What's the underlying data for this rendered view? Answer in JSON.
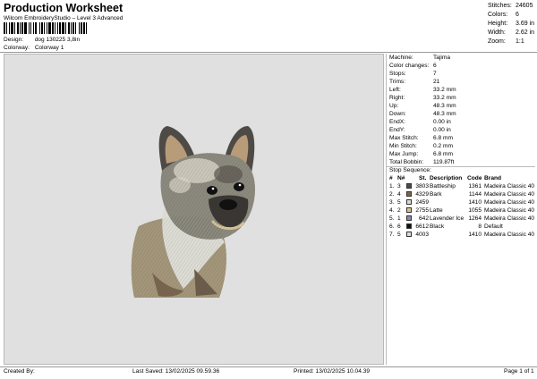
{
  "header": {
    "title": "Production Worksheet",
    "subtitle": "Wilcom EmbroideryStudio – Level 3 Advanced",
    "design_label": "Design:",
    "design_value": "dog 130225 3,8in",
    "colorway_label": "Colorway:",
    "colorway_value": "Colorway 1"
  },
  "top_stats": [
    {
      "label": "Stitches:",
      "value": "24605"
    },
    {
      "label": "Colors:",
      "value": "6"
    },
    {
      "label": "Height:",
      "value": "3.69 in"
    },
    {
      "label": "Width:",
      "value": "2.62 in"
    },
    {
      "label": "Zoom:",
      "value": "1:1"
    }
  ],
  "machine_info": [
    {
      "label": "Machine:",
      "value": "Tajima"
    },
    {
      "label": "Color changes:",
      "value": "6"
    },
    {
      "label": "Stops:",
      "value": "7"
    },
    {
      "label": "Trims:",
      "value": "21"
    },
    {
      "label": "Left:",
      "value": "33.2 mm"
    },
    {
      "label": "Right:",
      "value": "33.2 mm"
    },
    {
      "label": "Up:",
      "value": "48.3 mm"
    },
    {
      "label": "Down:",
      "value": "48.3 mm"
    },
    {
      "label": "EndX:",
      "value": "0.00 in"
    },
    {
      "label": "EndY:",
      "value": "0.00 in"
    },
    {
      "label": "Max Stitch:",
      "value": "6.8 mm"
    },
    {
      "label": "Min Stitch:",
      "value": "0.2 mm"
    },
    {
      "label": "Max Jump:",
      "value": "6.8 mm"
    },
    {
      "label": "Total Bobbin:",
      "value": "119.87ft"
    }
  ],
  "stop_sequence": {
    "title": "Stop Sequence:",
    "headers": {
      "hash": "#",
      "n": "N#",
      "st": "St.",
      "description": "Description",
      "code": "Code",
      "brand": "Brand"
    },
    "rows": [
      {
        "num": "1.",
        "n": "3",
        "color": "#4e4a46",
        "st": "3803",
        "description": "Battleship",
        "code": "1361",
        "brand": "Madeira Classic 40"
      },
      {
        "num": "2.",
        "n": "4",
        "color": "#7a6650",
        "st": "4329",
        "description": "Bark",
        "code": "1144",
        "brand": "Madeira Classic 40"
      },
      {
        "num": "3.",
        "n": "5",
        "color": "#dcdcd4",
        "st": "2459",
        "description": "",
        "code": "1410",
        "brand": "Madeira Classic 40"
      },
      {
        "num": "4.",
        "n": "2",
        "color": "#d8c498",
        "st": "2755",
        "description": "Latte",
        "code": "1055",
        "brand": "Madeira Classic 40"
      },
      {
        "num": "5.",
        "n": "1",
        "color": "#8c8ca8",
        "st": "642",
        "description": "Lavender Ice",
        "code": "1264",
        "brand": "Madeira Classic 40"
      },
      {
        "num": "6.",
        "n": "6",
        "color": "#111111",
        "st": "6612",
        "description": "Black",
        "code": "8",
        "brand": "Default"
      },
      {
        "num": "7.",
        "n": "5",
        "color": "#dcdcd4",
        "st": "4003",
        "description": "",
        "code": "1410",
        "brand": "Madeira Classic 40"
      }
    ]
  },
  "footer": {
    "created_by": "Created By:",
    "last_saved": "Last Saved: 13/02/2025 09.59.36",
    "printed": "Printed: 13/02/2025 10.04.39",
    "page": "Page 1 of 1"
  }
}
